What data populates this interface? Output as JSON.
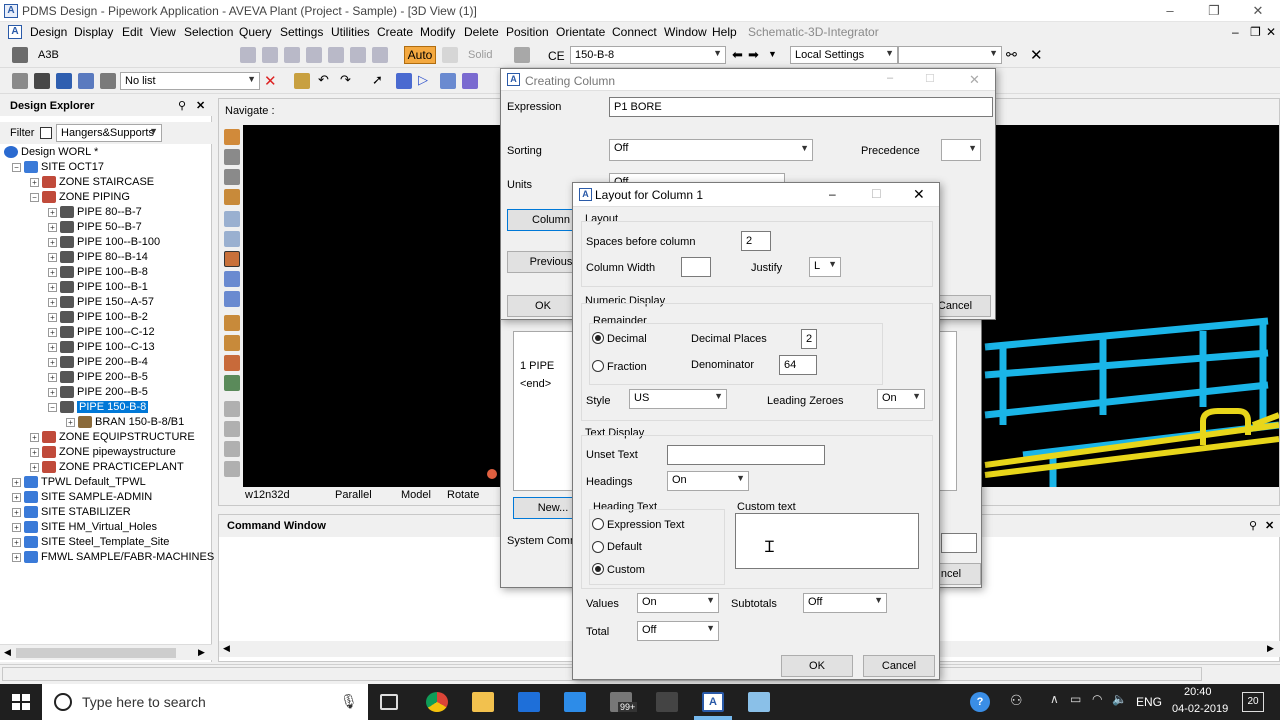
{
  "window": {
    "title": "PDMS Design - Pipework Application - AVEVA Plant (Project - Sample) - [3D View (1)]",
    "min": "–",
    "max": "❐",
    "close": "✕"
  },
  "menu": [
    "Design",
    "Display",
    "Edit",
    "View",
    "Selection",
    "Query",
    "Settings",
    "Utilities",
    "Create",
    "Modify",
    "Delete",
    "Position",
    "Orientate",
    "Connect",
    "Window",
    "Help",
    "Schematic-3D-Integrator"
  ],
  "toolbar1": {
    "a3b": "A3B",
    "auto": "Auto",
    "solid": "Solid",
    "ce_label": "CE",
    "ce_value": "150-B-8",
    "local_settings": "Local Settings"
  },
  "toolbar2": {
    "list_value": "No list"
  },
  "explorer": {
    "title": "Design Explorer",
    "filter_label": "Filter",
    "filter_value": "Hangers&Supports",
    "items": [
      "Design WORL *",
      "SITE OCT17",
      "ZONE STAIRCASE",
      "ZONE PIPING",
      "PIPE 80--B-7",
      "PIPE 50--B-7",
      "PIPE 100--B-100",
      "PIPE 80--B-14",
      "PIPE 100--B-8",
      "PIPE 100--B-1",
      "PIPE 150--A-57",
      "PIPE 100--B-2",
      "PIPE 100--C-12",
      "PIPE 100--C-13",
      "PIPE 200--B-4",
      "PIPE 200--B-5",
      "PIPE 200--B-5",
      "PIPE 150-B-8",
      "BRAN 150-B-8/B1",
      "ZONE EQUIPSTRUCTURE",
      "ZONE pipewaystructure",
      "ZONE PRACTICEPLANT",
      "TPWL Default_TPWL",
      "SITE SAMPLE-ADMIN",
      "SITE STABILIZER",
      "SITE HM_Virtual_Holes",
      "SITE Steel_Template_Site",
      "FMWL SAMPLE/FABR-MACHINES"
    ]
  },
  "view3d": {
    "navigate": "Navigate :",
    "status": [
      "w12n32d",
      "Parallel",
      "Model",
      "Rotate"
    ]
  },
  "command_window": {
    "title": "Command Window"
  },
  "creating_column": {
    "title": "Creating Column",
    "expression_label": "Expression",
    "expression_value": "P1 BORE",
    "sorting_label": "Sorting",
    "sorting_value": "Off",
    "precedence_label": "Precedence",
    "units_label": "Units",
    "units_value": "Off",
    "column_btn": "Column",
    "previous_btn": "Previous",
    "ok_btn": "OK",
    "cancel_btn": "Cancel"
  },
  "background_form": {
    "list": [
      "1 PIPE",
      "<end>"
    ],
    "new_btn": "New...",
    "system_comm": "System Comm",
    "cancel_btn": "ncel"
  },
  "layout_dialog": {
    "title": "Layout for Column 1",
    "layout_group": "Layout",
    "spaces_label": "Spaces before column",
    "spaces_value": "2",
    "width_label": "Column Width",
    "width_value": "",
    "justify_label": "Justify",
    "justify_value": "L",
    "numeric_group": "Numeric Display",
    "remainder_group": "Remainder",
    "decimal_label": "Decimal",
    "fraction_label": "Fraction",
    "decimal_places_label": "Decimal Places",
    "decimal_places_value": "2",
    "denominator_label": "Denominator",
    "denominator_value": "64",
    "style_label": "Style",
    "style_value": "US",
    "leading_label": "Leading Zeroes",
    "leading_value": "On",
    "text_group": "Text Display",
    "unset_label": "Unset Text",
    "unset_value": "",
    "headings_label": "Headings",
    "headings_value": "On",
    "heading_text_group": "Heading Text",
    "opt_expression": "Expression Text",
    "opt_default": "Default",
    "opt_custom": "Custom",
    "custom_text_label": "Custom text",
    "custom_text_value": "",
    "values_label": "Values",
    "values_value": "On",
    "subtotals_label": "Subtotals",
    "subtotals_value": "Off",
    "total_label": "Total",
    "total_value": "Off",
    "ok_btn": "OK",
    "cancel_btn": "Cancel"
  },
  "taskbar": {
    "search_placeholder": "Type here to search",
    "lang": "ENG",
    "time": "20:40",
    "date": "04-02-2019",
    "badge": "99+",
    "notif": "20"
  },
  "colors": {
    "accent": "#0078d7",
    "viewport_bg": "#000000",
    "pipe_cyan": "#1ab5e8",
    "pipe_yellow": "#e8d61a",
    "auto_btn": "#f4a940"
  }
}
